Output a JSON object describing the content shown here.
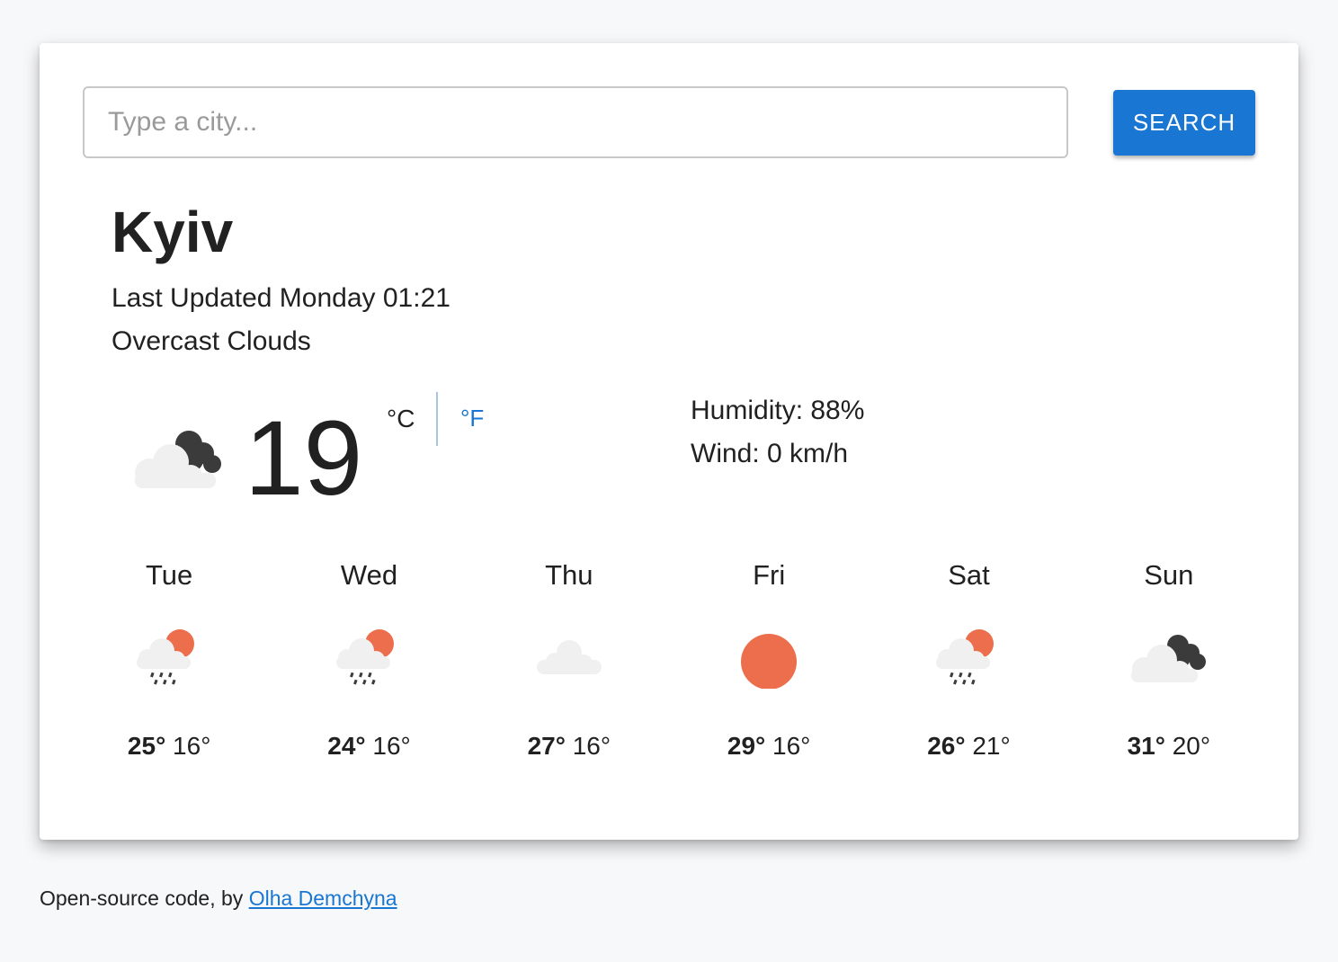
{
  "search": {
    "placeholder": "Type a city...",
    "value": "",
    "button_label": "SEARCH"
  },
  "current": {
    "city": "Kyiv",
    "last_updated": "Last Updated Monday 01:21",
    "description": "Overcast Clouds",
    "icon": "broken-clouds-icon",
    "temperature": "19",
    "unit_celsius": "°C",
    "unit_fahrenheit": "°F",
    "humidity": "Humidity: 88%",
    "wind": "Wind: 0 km/h"
  },
  "forecast": [
    {
      "day": "Tue",
      "icon": "rain-sun-icon",
      "max": "25°",
      "min": "16°"
    },
    {
      "day": "Wed",
      "icon": "rain-sun-icon",
      "max": "24°",
      "min": "16°"
    },
    {
      "day": "Thu",
      "icon": "cloud-icon",
      "max": "27°",
      "min": "16°"
    },
    {
      "day": "Fri",
      "icon": "sun-icon",
      "max": "29°",
      "min": "16°"
    },
    {
      "day": "Sat",
      "icon": "rain-sun-icon",
      "max": "26°",
      "min": "21°"
    },
    {
      "day": "Sun",
      "icon": "broken-clouds-icon",
      "max": "31°",
      "min": "20°"
    }
  ],
  "footer": {
    "text": "Open-source code, by ",
    "link_label": "Olha Demchyna"
  },
  "colors": {
    "accent": "#1976d2",
    "sun": "#ec6e4c",
    "cloud_light": "#f0f0f0",
    "cloud_dark": "#3b3b3b"
  }
}
